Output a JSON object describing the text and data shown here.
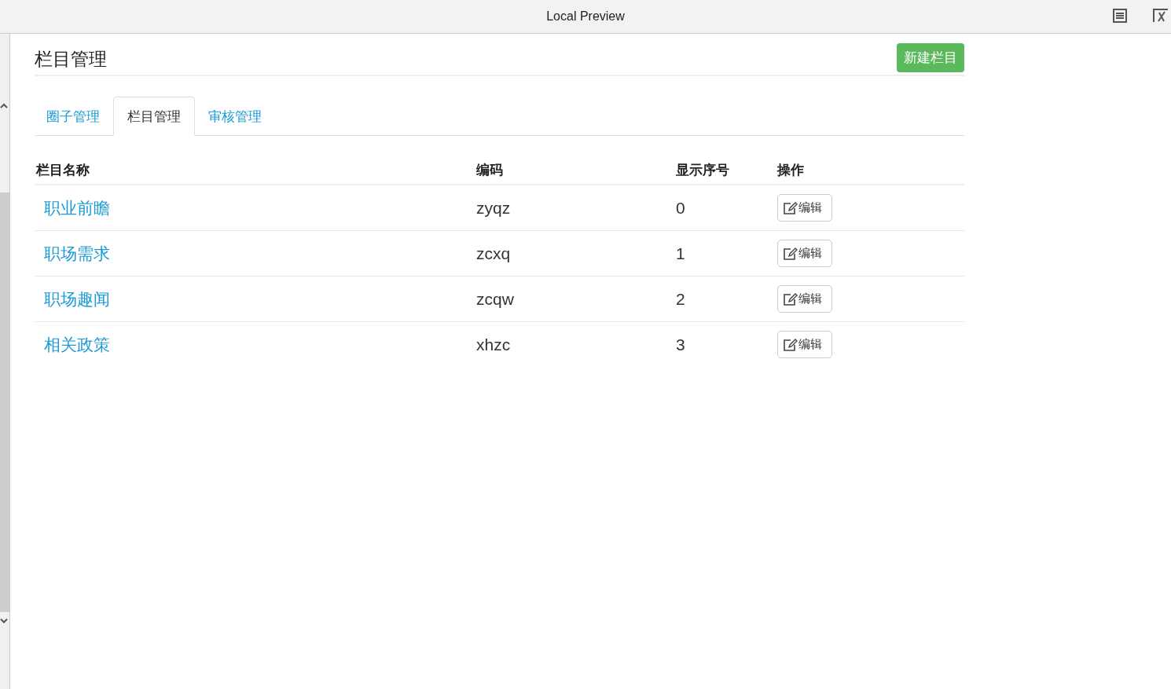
{
  "window": {
    "title": "Local Preview"
  },
  "page": {
    "title": "栏目管理",
    "new_button": "新建栏目"
  },
  "tabs": [
    {
      "label": "圈子管理",
      "selected": false
    },
    {
      "label": "栏目管理",
      "selected": true
    },
    {
      "label": "审核管理",
      "selected": false
    }
  ],
  "table": {
    "columns": [
      "栏目名称",
      "编码",
      "显示序号",
      "操作"
    ],
    "rows": [
      {
        "name": "职业前瞻",
        "code": "zyqz",
        "order": "0",
        "action": "编辑"
      },
      {
        "name": "职场需求",
        "code": "zcxq",
        "order": "1",
        "action": "编辑"
      },
      {
        "name": "职场趣闻",
        "code": "zcqw",
        "order": "2",
        "action": "编辑"
      },
      {
        "name": "相关政策",
        "code": "xhzc",
        "order": "3",
        "action": "编辑"
      }
    ]
  }
}
